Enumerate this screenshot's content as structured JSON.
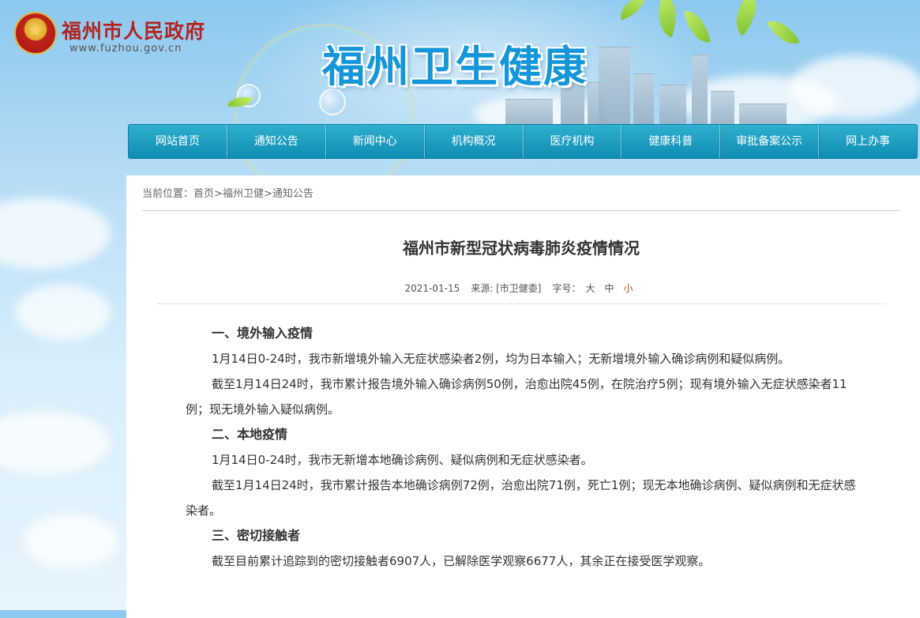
{
  "gov": {
    "title": "福州市人民政府",
    "url": "www.fuzhou.gov.cn"
  },
  "site": {
    "title": "福州卫生健康"
  },
  "nav": [
    "网站首页",
    "通知公告",
    "新闻中心",
    "机构概况",
    "医疗机构",
    "健康科普",
    "审批备案公示",
    "网上办事"
  ],
  "breadcrumb": {
    "prefix": "当前位置：",
    "home": "首页",
    "sep1": ">",
    "section": "福州卫健",
    "sep2": ">",
    "current": "通知公告"
  },
  "article": {
    "title": "福州市新型冠状病毒肺炎疫情情况",
    "date": "2021-01-15",
    "source": "来源: [市卫健委]",
    "font_label": "字号：",
    "font_large": "大",
    "font_medium": "中",
    "font_small": "小",
    "paragraphs": [
      {
        "type": "heading",
        "text": "一、境外输入疫情"
      },
      {
        "type": "text",
        "text": "1月14日0-24时，我市新增境外输入无症状感染者2例，均为日本输入；无新增境外输入确诊病例和疑似病例。"
      },
      {
        "type": "text",
        "text": "截至1月14日24时，我市累计报告境外输入确诊病例50例，治愈出院45例，在院治疗5例；现有境外输入无症状感染者11例；现无境外输入疑似病例。"
      },
      {
        "type": "heading",
        "text": "二、本地疫情"
      },
      {
        "type": "text",
        "text": "1月14日0-24时，我市无新增本地确诊病例、疑似病例和无症状感染者。"
      },
      {
        "type": "text",
        "text": "截至1月14日24时，我市累计报告本地确诊病例72例，治愈出院71例，死亡1例；现无本地确诊病例、疑似病例和无症状感染者。"
      },
      {
        "type": "heading",
        "text": "三、密切接触者"
      },
      {
        "type": "text",
        "text": "截至目前累计追踪到的密切接触者6907人，已解除医学观察6677人，其余正在接受医学观察。"
      }
    ]
  },
  "colors": {
    "nav_bg": "#1a9cc2",
    "gov_red": "#b2251f",
    "site_blue": "#1496d8",
    "font_small_active": "#d9451e"
  }
}
